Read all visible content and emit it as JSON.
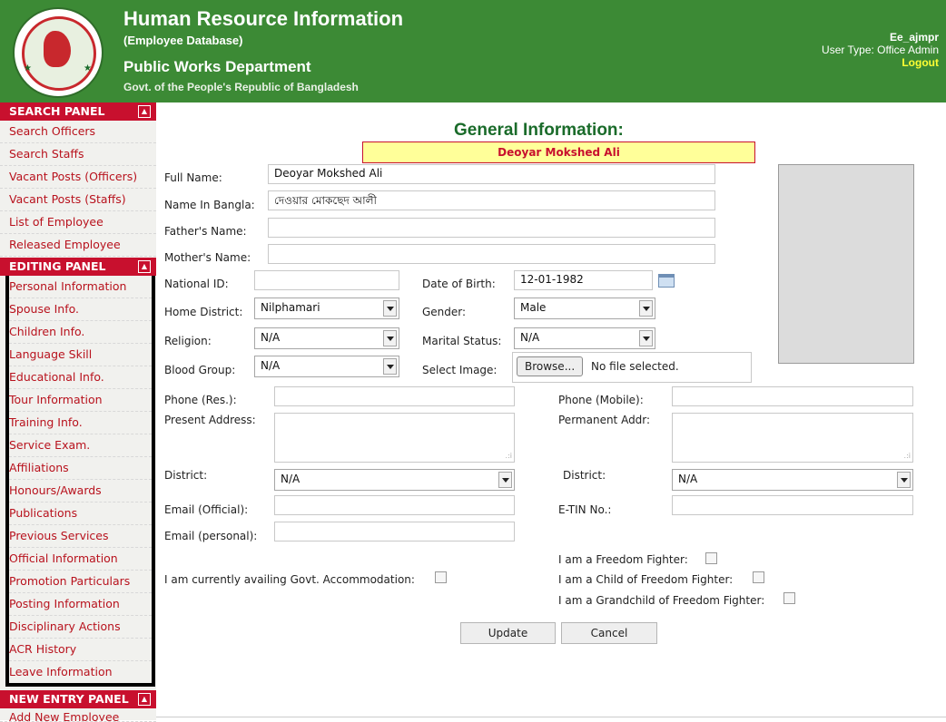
{
  "header": {
    "title": "Human Resource Information",
    "subtitle": "(Employee Database)",
    "department": "Public Works Department",
    "government": "Govt. of the People's Republic of Bangladesh",
    "user_name": "Ee_ajmpr",
    "user_type": "User Type: Office Admin",
    "logout_label": "Logout",
    "accent_color": "#3c8a35"
  },
  "sidebar": {
    "search_panel": {
      "title": "SEARCH PANEL",
      "items": [
        "Search Officers",
        "Search Staffs",
        "Vacant Posts (Officers)",
        "Vacant Posts (Staffs)",
        "List of Employee",
        "Released Employee"
      ]
    },
    "editing_panel": {
      "title": "EDITING PANEL",
      "items": [
        "Personal Information",
        "Spouse Info.",
        "Children Info.",
        "Language Skill",
        "Educational Info.",
        "Tour Information",
        "Training Info.",
        "Service Exam.",
        "Affiliations",
        "Honours/Awards",
        "Publications",
        "Previous Services",
        "Official Information",
        "Promotion Particulars",
        "Posting Information",
        "Disciplinary Actions",
        "ACR History",
        "Leave Information"
      ]
    },
    "new_entry_panel": {
      "title": "NEW ENTRY PANEL",
      "items": [
        "Add New Employee"
      ]
    },
    "toggle_glyph": "▲"
  },
  "main": {
    "title": "General Information:",
    "employee_banner": "Deoyar Mokshed Ali",
    "fields": {
      "full_name": {
        "label": "Full Name:",
        "value": "Deoyar Mokshed Ali"
      },
      "name_bangla": {
        "label": "Name In Bangla:",
        "value": "দেওয়ার মোকছেদ আলী"
      },
      "father_name": {
        "label": "Father's Name:",
        "value": ""
      },
      "mother_name": {
        "label": "Mother's Name:",
        "value": ""
      },
      "national_id": {
        "label": "National ID:",
        "value": ""
      },
      "dob": {
        "label": "Date of Birth:",
        "value": "12-01-1982"
      },
      "home_district": {
        "label": "Home District:",
        "value": "Nilphamari"
      },
      "gender": {
        "label": "Gender:",
        "value": "Male"
      },
      "religion": {
        "label": "Religion:",
        "value": "N/A"
      },
      "marital_status": {
        "label": "Marital Status:",
        "value": "N/A"
      },
      "blood_group": {
        "label": "Blood Group:",
        "value": "N/A"
      },
      "select_image": {
        "label": "Select Image:",
        "button": "Browse...",
        "status": "No file selected."
      },
      "phone_res": {
        "label": "Phone (Res.):",
        "value": ""
      },
      "phone_mobile": {
        "label": "Phone (Mobile):",
        "value": ""
      },
      "present_address": {
        "label": "Present Address:",
        "value": ""
      },
      "permanent_address": {
        "label": "Permanent Addr:",
        "value": ""
      },
      "district_present": {
        "label": "District:",
        "value": "N/A"
      },
      "district_permanent": {
        "label": "District:",
        "value": "N/A"
      },
      "email_official": {
        "label": "Email (Official):",
        "value": ""
      },
      "etin": {
        "label": "E-TIN No.:",
        "value": ""
      },
      "email_personal": {
        "label": "Email (personal):",
        "value": ""
      }
    },
    "checkboxes": {
      "govt_accommodation": "I am currently availing Govt. Accommodation:",
      "freedom_fighter": "I am a Freedom Fighter:",
      "child_freedom_fighter": "I am a Child of Freedom Fighter:",
      "grandchild_freedom_fighter": "I am a Grandchild of Freedom Fighter:"
    },
    "update_label": "Update",
    "cancel_label": "Cancel"
  }
}
